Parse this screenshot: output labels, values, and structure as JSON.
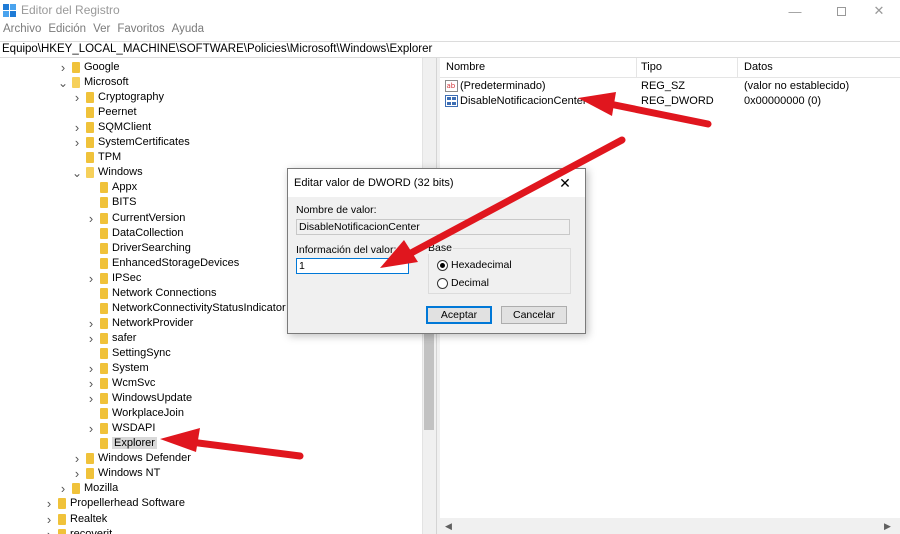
{
  "window": {
    "title": "Editor del Registro",
    "minimize_glyph": "—",
    "close_glyph": "✕"
  },
  "menu": [
    "Archivo",
    "Edición",
    "Ver",
    "Favoritos",
    "Ayuda"
  ],
  "address": "Equipo\\HKEY_LOCAL_MACHINE\\SOFTWARE\\Policies\\Microsoft\\Windows\\Explorer",
  "tree": [
    {
      "label": "Google",
      "level": 1,
      "expander": ">"
    },
    {
      "label": "Microsoft",
      "level": 1,
      "expander": "v"
    },
    {
      "label": "Cryptography",
      "level": 2,
      "expander": ">"
    },
    {
      "label": "Peernet",
      "level": 2,
      "expander": ""
    },
    {
      "label": "SQMClient",
      "level": 2,
      "expander": ">"
    },
    {
      "label": "SystemCertificates",
      "level": 2,
      "expander": ">"
    },
    {
      "label": "TPM",
      "level": 2,
      "expander": ""
    },
    {
      "label": "Windows",
      "level": 2,
      "expander": "v"
    },
    {
      "label": "Appx",
      "level": 3,
      "expander": ""
    },
    {
      "label": "BITS",
      "level": 3,
      "expander": ""
    },
    {
      "label": "CurrentVersion",
      "level": 3,
      "expander": ">"
    },
    {
      "label": "DataCollection",
      "level": 3,
      "expander": ""
    },
    {
      "label": "DriverSearching",
      "level": 3,
      "expander": ""
    },
    {
      "label": "EnhancedStorageDevices",
      "level": 3,
      "expander": ""
    },
    {
      "label": "IPSec",
      "level": 3,
      "expander": ">"
    },
    {
      "label": "Network Connections",
      "level": 3,
      "expander": ""
    },
    {
      "label": "NetworkConnectivityStatusIndicator",
      "level": 3,
      "expander": ""
    },
    {
      "label": "NetworkProvider",
      "level": 3,
      "expander": ">"
    },
    {
      "label": "safer",
      "level": 3,
      "expander": ">"
    },
    {
      "label": "SettingSync",
      "level": 3,
      "expander": ""
    },
    {
      "label": "System",
      "level": 3,
      "expander": ">"
    },
    {
      "label": "WcmSvc",
      "level": 3,
      "expander": ">"
    },
    {
      "label": "WindowsUpdate",
      "level": 3,
      "expander": ">"
    },
    {
      "label": "WorkplaceJoin",
      "level": 3,
      "expander": ""
    },
    {
      "label": "WSDAPI",
      "level": 3,
      "expander": ">"
    },
    {
      "label": "Explorer",
      "level": 3,
      "expander": "",
      "selected": true
    },
    {
      "label": "Windows Defender",
      "level": 2,
      "expander": ">"
    },
    {
      "label": "Windows NT",
      "level": 2,
      "expander": ">"
    },
    {
      "label": "Mozilla",
      "level": 1,
      "expander": ">"
    },
    {
      "label": "Propellerhead Software",
      "level": 0,
      "expander": ">"
    },
    {
      "label": "Realtek",
      "level": 0,
      "expander": ">"
    },
    {
      "label": "recoverit",
      "level": 0,
      "expander": ">"
    }
  ],
  "list": {
    "columns": [
      "Nombre",
      "Tipo",
      "Datos"
    ],
    "rows": [
      {
        "name": "(Predeterminado)",
        "type": "REG_SZ",
        "data": "(valor no establecido)",
        "icon": "string-value-icon"
      },
      {
        "name": "DisableNotificacionCenter",
        "type": "REG_DWORD",
        "data": "0x00000000 (0)",
        "icon": "dword-value-icon"
      }
    ]
  },
  "dialog": {
    "title": "Editar valor de DWORD (32 bits)",
    "close_glyph": "✕",
    "name_label": "Nombre de valor:",
    "name_value": "DisableNotificacionCenter",
    "data_label": "Información del valor:",
    "data_value": "1",
    "base_label": "Base",
    "radio_hex": "Hexadecimal",
    "radio_dec": "Decimal",
    "selected_base": "Hexadecimal",
    "ok_label": "Aceptar",
    "cancel_label": "Cancelar"
  },
  "annotation_color": "#e0161e"
}
